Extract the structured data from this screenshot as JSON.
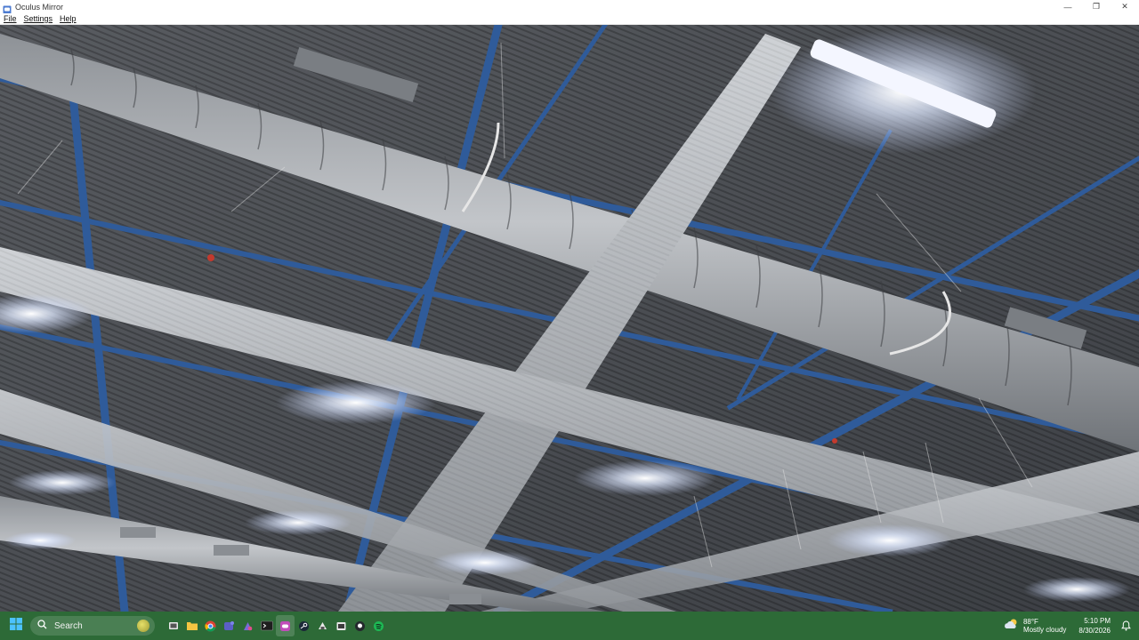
{
  "window": {
    "title": "Oculus Mirror",
    "controls": {
      "minimize": "—",
      "restore": "❐",
      "close": "✕"
    }
  },
  "menu": {
    "items": [
      {
        "label": "File"
      },
      {
        "label": "Settings"
      },
      {
        "label": "Help"
      }
    ]
  },
  "viewport": {
    "scene": "vr-warehouse-ceiling-mirror",
    "colors": {
      "steel_beam": "#2f5b9a",
      "duct": "#b9bcc0",
      "ceiling": "#5a5d62",
      "light": "#ffffff"
    }
  },
  "taskbar": {
    "search_placeholder": "Search",
    "icons": [
      "start-icon",
      "task-view-icon",
      "file-explorer-icon",
      "chrome-icon",
      "teams-icon",
      "app-icon",
      "terminal-icon",
      "oculus-icon",
      "steam-icon",
      "app2-icon",
      "app3-icon",
      "github-icon",
      "spotify-icon"
    ],
    "active_icon": "oculus-icon",
    "weather": {
      "temp": "88°F",
      "desc": "Mostly cloudy"
    },
    "clock": {
      "time": "5:10 PM",
      "date": "8/30/2026"
    },
    "background": "#2d6a37"
  }
}
